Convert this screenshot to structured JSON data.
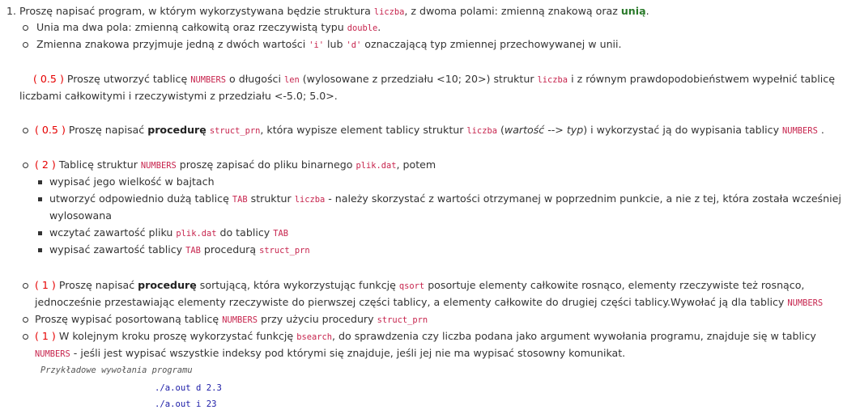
{
  "l1": {
    "num": "1.",
    "t1": "Proszę napisać program, w którym wykorzystywana będzie  struktura ",
    "c1": "liczba",
    "t2": ", z dwoma polami: zmienną znakową oraz ",
    "g1": "unią",
    "t3": "."
  },
  "l2": {
    "t1": "Unia ma dwa pola: zmienną całkowitą oraz rzeczywistą typu ",
    "c1": "double",
    "t2": "."
  },
  "l3": {
    "t1": "Zmienna znakowa przyjmuje jedną z dwóch wartości ",
    "c1": "'i'",
    "t2": " lub ",
    "c2": "'d'",
    "t3": " oznaczającą typ zmiennej przechowywanej w unii."
  },
  "l4": {
    "p": "( 0.5 )",
    "t1": " Proszę utworzyć tablicę ",
    "c1": "NUMBERS",
    "t2": " o długości ",
    "c2": "len",
    "t3": " (wylosowane z przedziału <10; 20>) struktur ",
    "c3": "liczba",
    "t4": " i z równym prawdopodobieństwem wypełnić tablicę"
  },
  "l5": {
    "t1": "liczbami całkowitymi i rzeczywistymi z przedziału <-5.0; 5.0>."
  },
  "l6": {
    "p": "( 0.5 )",
    "t1": " Proszę napisać ",
    "b1": "procedurę",
    "t2": " ",
    "c1": "struct_prn",
    "t3": ", która wypisze element tablicy struktur ",
    "c2": "liczba",
    "t4": " (",
    "i1": "wartość --> typ",
    "t5": ") i wykorzystać ją do wypisania tablicy ",
    "c3": "NUMBERS",
    "t6": " ."
  },
  "l7": {
    "p": "( 2 )",
    "t1": " Tablicę struktur ",
    "c1": "NUMBERS",
    "t2": " proszę zapisać do pliku binarnego ",
    "c2": "plik.dat",
    "t3": ", potem"
  },
  "l8": {
    "t1": "wypisać jego wielkość w bajtach"
  },
  "l9": {
    "t1": "utworzyć odpowiednio dużą tablicę ",
    "c1": "TAB",
    "t2": " struktur ",
    "c2": "liczba",
    "t3": " - należy skorzystać z wartości otrzymanej w poprzednim punkcie, a nie z tej, która została wcześniej"
  },
  "l10": {
    "t1": "wylosowana"
  },
  "l11": {
    "t1": "wczytać zawartość pliku ",
    "c1": "plik.dat",
    "t2": " do tablicy ",
    "c2": "TAB"
  },
  "l12": {
    "t1": "wypisać zawartość tablicy ",
    "c1": "TAB",
    "t2": " procedurą ",
    "c2": "struct_prn"
  },
  "l13": {
    "p": "( 1 )",
    "t1": " Proszę napisać ",
    "b1": "procedurę",
    "t2": " sortującą, która wykorzystując funkcję ",
    "c1": "qsort",
    "t3": " posortuje elementy całkowite rosnąco, elementy rzeczywiste też rosnąco,"
  },
  "l14": {
    "t1": "jednocześnie przestawiając elementy rzeczywiste do pierwszej części tablicy, a elementy całkowite do drugiej części tablicy.Wywołać ją dla tablicy ",
    "c1": "NUMBERS"
  },
  "l15": {
    "t1": "Proszę wypisać posortowaną tablicę ",
    "c1": "NUMBERS",
    "t2": " przy użyciu procedury ",
    "c2": "struct_prn"
  },
  "l16": {
    "p": "( 1 )",
    "t1": " W kolejnym kroku  proszę wykorzystać funkcję ",
    "c1": "bsearch",
    "t2": ", do sprawdzenia czy liczba podana jako argument wywołania programu, znajduje się w tablicy"
  },
  "l17": {
    "c1": "NUMBERS",
    "t1": " - jeśli jest wypisać wszystkie indeksy pod którymi się znajduje, jeśli jej nie ma wypisać  stosowny komunikat."
  },
  "example": {
    "label": "Przykładowe wywołania programu",
    "cmd1": "./a.out d 2.3",
    "cmd2": "./a.out i 23"
  }
}
